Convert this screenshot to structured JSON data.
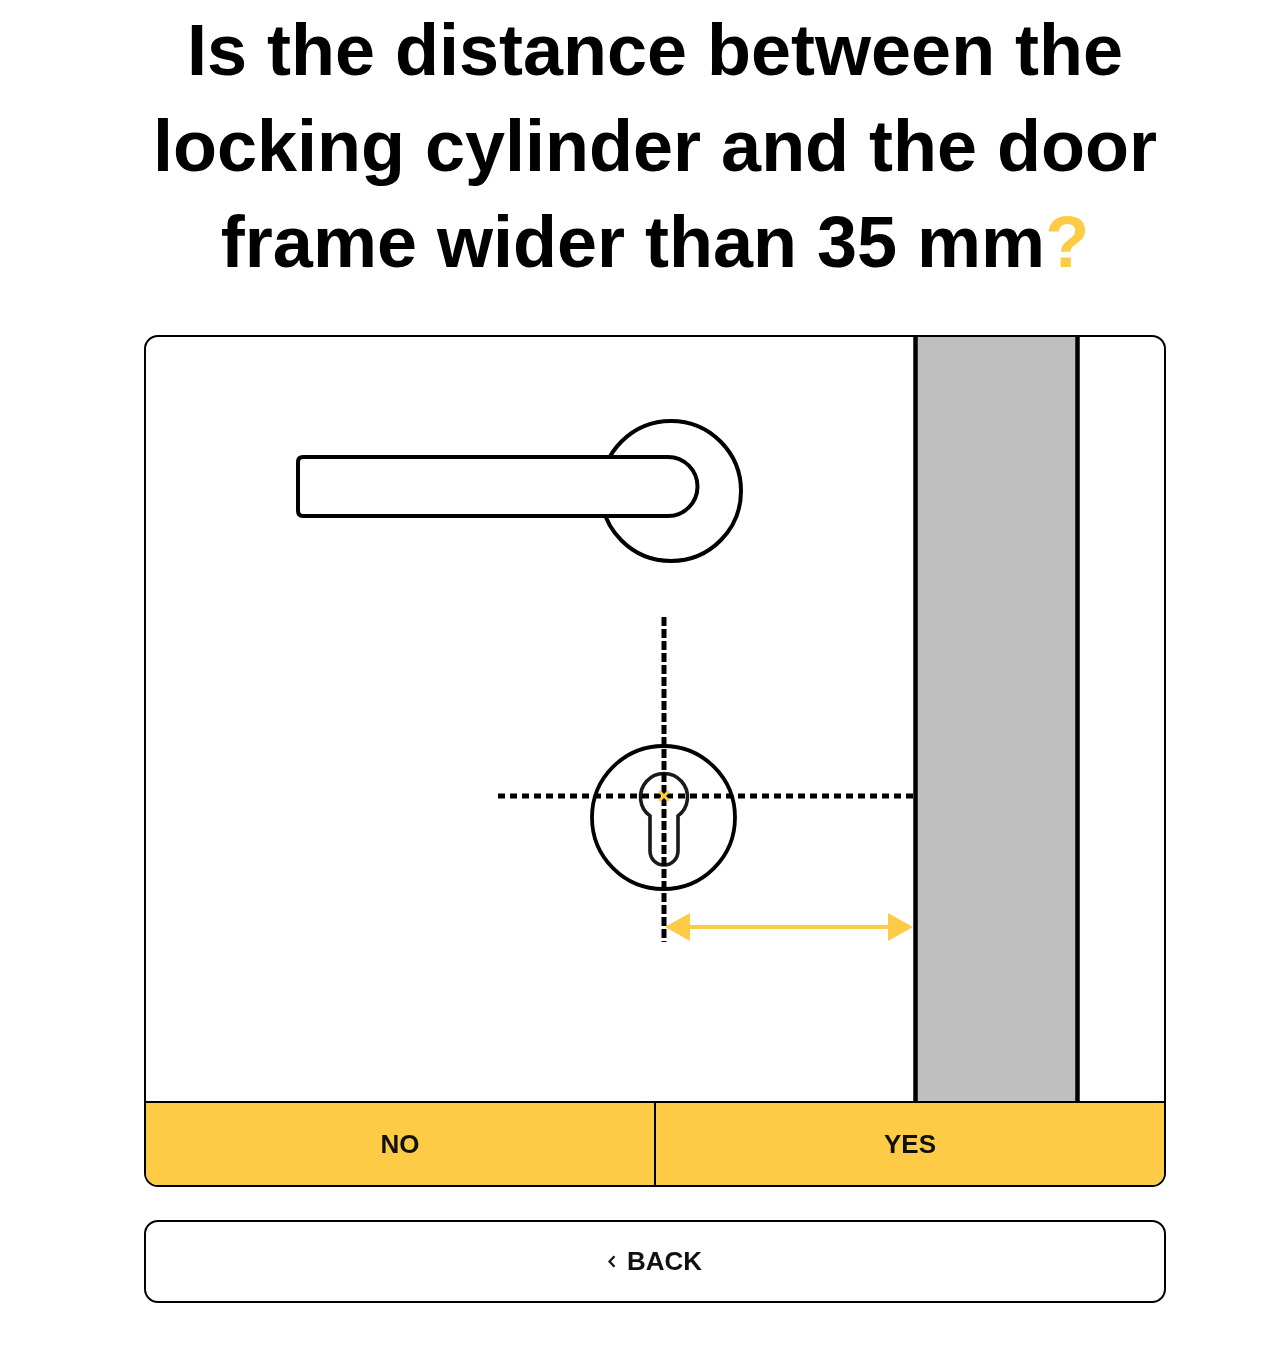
{
  "title": {
    "text": "Is the distance between the locking cylinder and the door frame wider than 35 mm",
    "accent": "?"
  },
  "answers": [
    {
      "label": "NO"
    },
    {
      "label": "YES"
    }
  ],
  "back_button": {
    "label": "BACK"
  }
}
